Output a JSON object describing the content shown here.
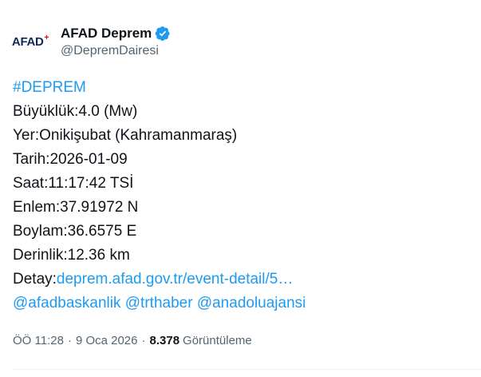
{
  "author": {
    "display_name": "AFAD Deprem",
    "handle": "@DepremDairesi",
    "avatar_logo_text": "AFAD",
    "avatar_logo_mark": "+",
    "verified": true,
    "verified_icon": "verified-badge-icon"
  },
  "tweet": {
    "hashtag": "#DEPREM",
    "lines": [
      "Büyüklük:4.0 (Mw)",
      "Yer:Onikişubat (Kahramanmaraş)",
      "Tarih:2026-01-09",
      "Saat:11:17:42 TSİ",
      "Enlem:37.91972 N",
      "Boylam:36.6575 E",
      "Derinlik:12.36 km"
    ],
    "detail_label": "Detay:",
    "detail_link": "deprem.afad.gov.tr/event-detail/5…",
    "mentions": [
      "@afadbaskanlik",
      "@trthaber",
      "@anadoluajansi"
    ]
  },
  "meta": {
    "time": "ÖÖ 11:28",
    "separator": "·",
    "date": "9 Oca 2026",
    "views_count": "8.378",
    "views_label": "Görüntüleme"
  },
  "colors": {
    "link": "#1d9bf0",
    "text": "#0f1419",
    "muted": "#536471",
    "verified": "#1d9bf0"
  }
}
